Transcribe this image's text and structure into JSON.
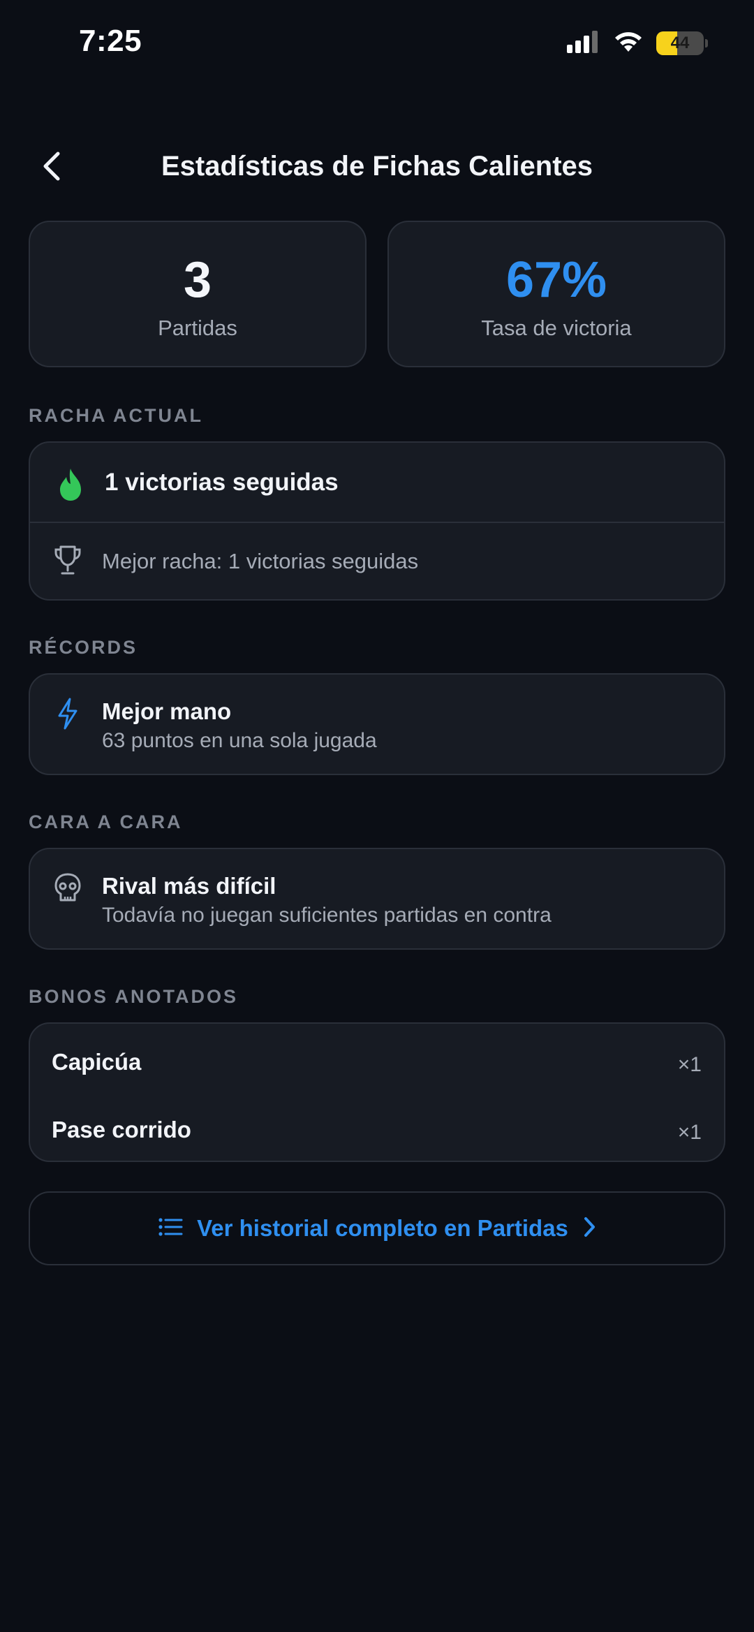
{
  "status_bar": {
    "time": "7:25",
    "battery_level": "44",
    "battery_fraction": 0.44,
    "icons": [
      "signal-icon",
      "wifi-icon",
      "battery-icon"
    ]
  },
  "header": {
    "title": "Estadísticas de Fichas Calientes",
    "back_icon": "chevron-left-icon"
  },
  "stats": {
    "games_value": "3",
    "games_label": "Partidas",
    "winrate_value": "67%",
    "winrate_label": "Tasa de victoria"
  },
  "streak": {
    "section_title": "RACHA ACTUAL",
    "current": "1 victorias seguidas",
    "current_icon": "flame-icon",
    "best": "Mejor racha: 1 victorias seguidas",
    "best_icon": "trophy-icon"
  },
  "records": {
    "section_title": "RÉCORDS",
    "title": "Mejor mano",
    "subtitle": "63 puntos en una sola jugada",
    "icon": "bolt-icon"
  },
  "head_to_head": {
    "section_title": "CARA A CARA",
    "title": "Rival más difícil",
    "subtitle": "Todavía no juegan suficientes partidas en contra",
    "icon": "skull-icon"
  },
  "bonuses": {
    "section_title": "BONOS ANOTADOS",
    "items": [
      {
        "name": "Capicúa",
        "count": "×1"
      },
      {
        "name": "Pase corrido",
        "count": "×1"
      }
    ]
  },
  "history_button": {
    "label": "Ver historial completo en Partidas",
    "icon": "list-icon",
    "trailing_icon": "chevron-right-icon"
  },
  "colors": {
    "background": "#0b0e15",
    "card": "#171b23",
    "accent": "#2f8ff0",
    "flame": "#34c759",
    "battery": "#f7d21c"
  }
}
